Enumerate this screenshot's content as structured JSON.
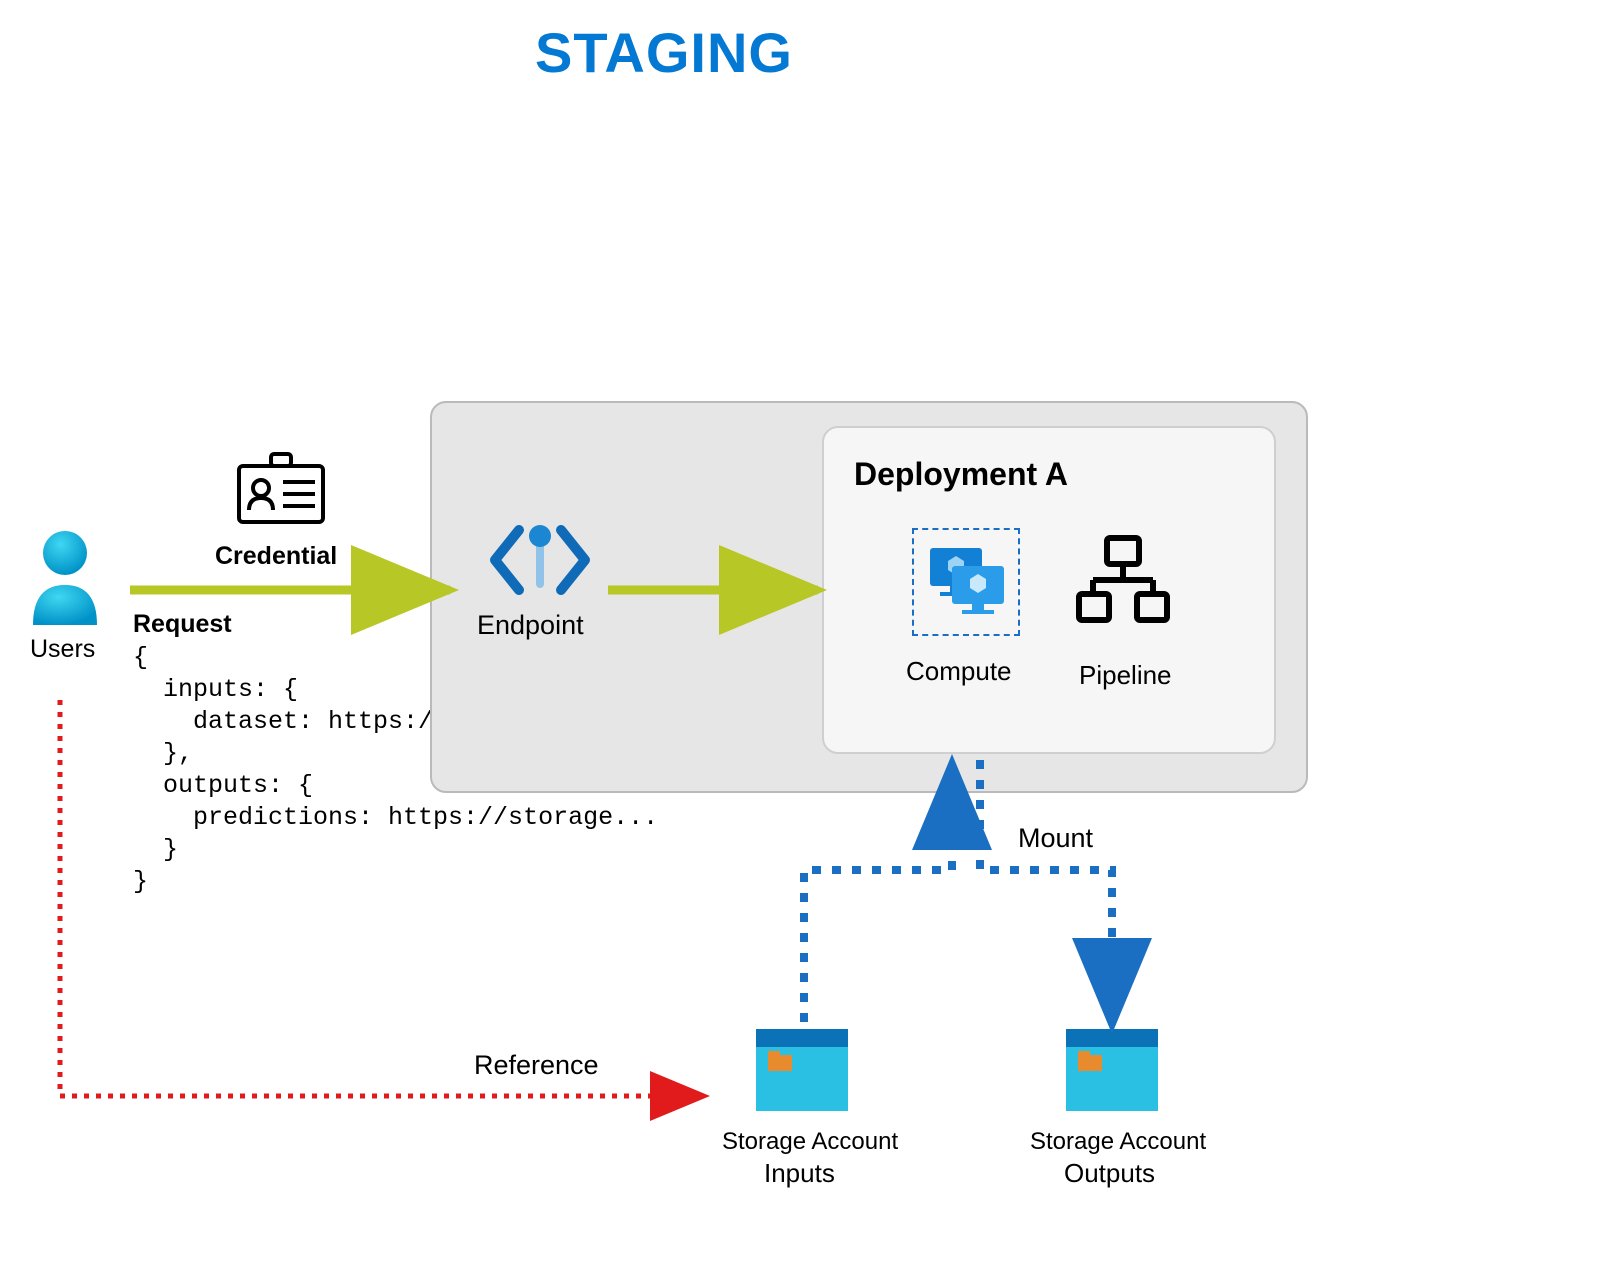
{
  "title": "STAGING",
  "users_label": "Users",
  "credential_label": "Credential",
  "request_label": "Request",
  "request_body": "{\n  inputs: {\n    dataset: https://storage...\n  },\n  outputs: {\n    predictions: https://storage...\n  }\n}",
  "endpoint_label": "Endpoint",
  "deployment_title": "Deployment A",
  "compute_label": "Compute",
  "pipeline_label": "Pipeline",
  "mount_label": "Mount",
  "reference_label": "Reference",
  "storage": {
    "label": "Storage Account",
    "inputs": "Inputs",
    "outputs": "Outputs"
  },
  "colors": {
    "title_blue": "#0379d3",
    "arrow_green": "#b7c725",
    "mount_blue": "#1b6fc2",
    "reference_red": "#e11b1b",
    "storage_cyan": "#2ac0e4",
    "storage_top": "#0c72b8"
  }
}
